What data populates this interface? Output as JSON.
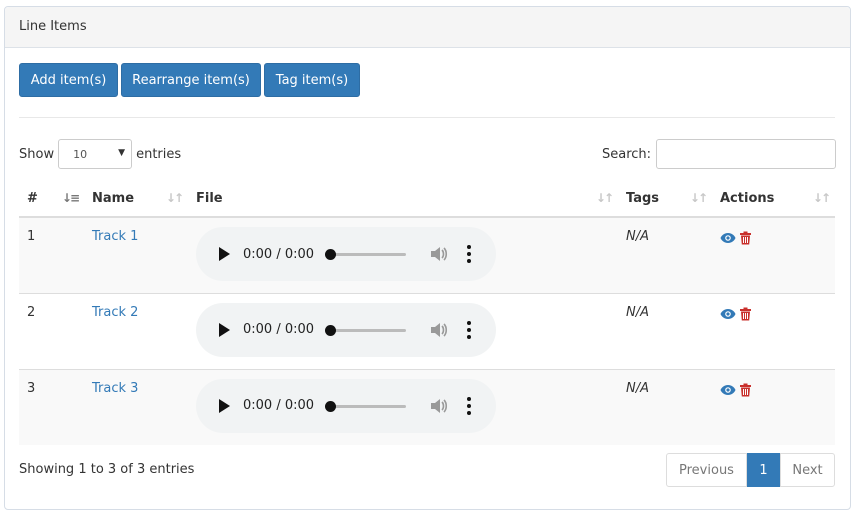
{
  "panel": {
    "title": "Line Items"
  },
  "buttons": {
    "add": "Add item(s)",
    "rearrange": "Rearrange item(s)",
    "tag": "Tag item(s)"
  },
  "length_control": {
    "show_label": "Show",
    "value": "10",
    "entries_label": "entries"
  },
  "search": {
    "label": "Search:",
    "value": "",
    "placeholder": ""
  },
  "table": {
    "headers": [
      "#",
      "Name",
      "File",
      "Tags",
      "Actions"
    ],
    "rows": [
      {
        "num": "1",
        "name": "Track 1",
        "time": "0:00 / 0:00",
        "tags": "N/A"
      },
      {
        "num": "2",
        "name": "Track 2",
        "time": "0:00 / 0:00",
        "tags": "N/A"
      },
      {
        "num": "3",
        "name": "Track 3",
        "time": "0:00 / 0:00",
        "tags": "N/A"
      }
    ]
  },
  "footer": {
    "info": "Showing 1 to 3 of 3 entries"
  },
  "pagination": {
    "previous": "Previous",
    "current": "1",
    "next": "Next"
  },
  "icons": {
    "view": "eye-icon",
    "delete": "trash-icon",
    "play": "play-icon",
    "volume": "volume-icon",
    "menu": "more-vert-icon"
  },
  "colors": {
    "primary": "#337ab7",
    "danger": "#c9302c",
    "link": "#337ab7"
  }
}
